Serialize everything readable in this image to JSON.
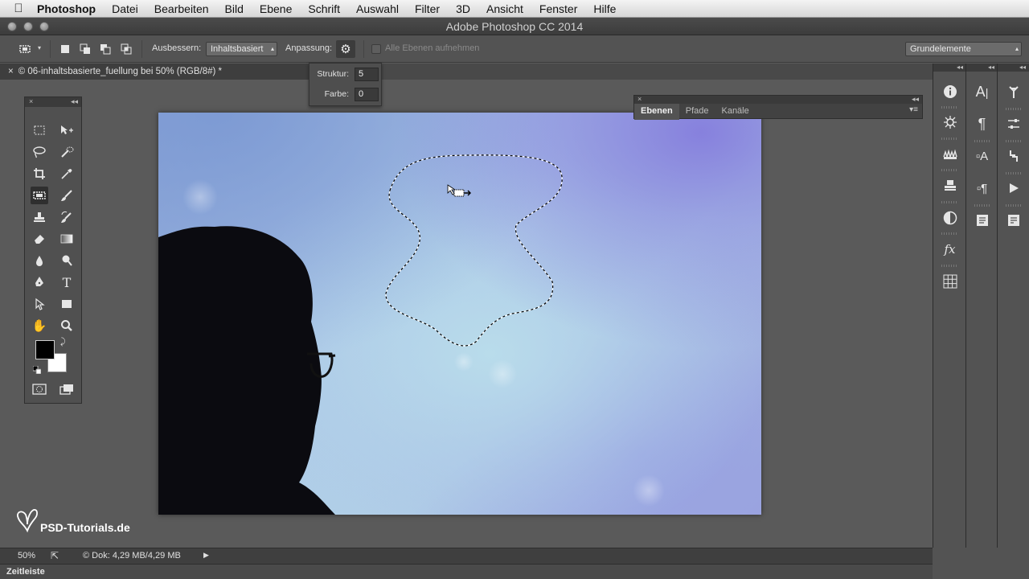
{
  "menubar": {
    "app": "Photoshop",
    "items": [
      "Datei",
      "Bearbeiten",
      "Bild",
      "Ebene",
      "Schrift",
      "Auswahl",
      "Filter",
      "3D",
      "Ansicht",
      "Fenster",
      "Hilfe"
    ]
  },
  "window": {
    "title": "Adobe Photoshop CC 2014"
  },
  "options": {
    "ausbessern_label": "Ausbessern:",
    "ausbessern_value": "Inhaltsbasiert",
    "anpassung_label": "Anpassung:",
    "alle_ebenen": "Alle Ebenen aufnehmen",
    "workspace": "Grundelemente"
  },
  "popup": {
    "struktur_label": "Struktur:",
    "struktur_value": "5",
    "farbe_label": "Farbe:",
    "farbe_value": "0"
  },
  "document": {
    "tab_title": "© 06-inhaltsbasierte_fuellung bei 50% (RGB/8#) *"
  },
  "layers_panel": {
    "tabs": [
      "Ebenen",
      "Pfade",
      "Kanäle"
    ]
  },
  "status": {
    "zoom": "50%",
    "doc": "© Dok: 4,29 MB/4,29 MB"
  },
  "timeline": {
    "label": "Zeitleiste"
  },
  "watermark": {
    "text": "PSD-Tutorials.de"
  }
}
